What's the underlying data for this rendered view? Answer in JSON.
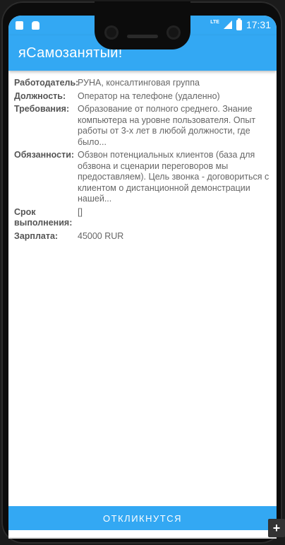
{
  "status_bar": {
    "lte": "LTE",
    "time": "17:31"
  },
  "app": {
    "title": "яСамозанятый!"
  },
  "details": [
    {
      "label": "Работодатель:",
      "value": "РУНА, консалтинговая группа"
    },
    {
      "label": "Должность:",
      "value": "Оператор на телефоне (удаленно)"
    },
    {
      "label": "Требования:",
      "value": "Образование от полного среднего. Знание компьютера на уровне пользователя. Опыт работы от 3-х лет в любой должности, где было..."
    },
    {
      "label": "Обязанности:",
      "value": "Обзвон потенциальных клиентов (база для обзвона и сценарии переговоров мы предоставляем). Цель звонка - договориться с клиентом о дистанционной демонстрации нашей..."
    },
    {
      "label": "Срок выполнения:",
      "value": "[]"
    },
    {
      "label": "Зарплата:",
      "value": "45000 RUR"
    }
  ],
  "action": {
    "label": "ОТКЛИКНУТСЯ"
  },
  "fab": {
    "label": "+"
  }
}
